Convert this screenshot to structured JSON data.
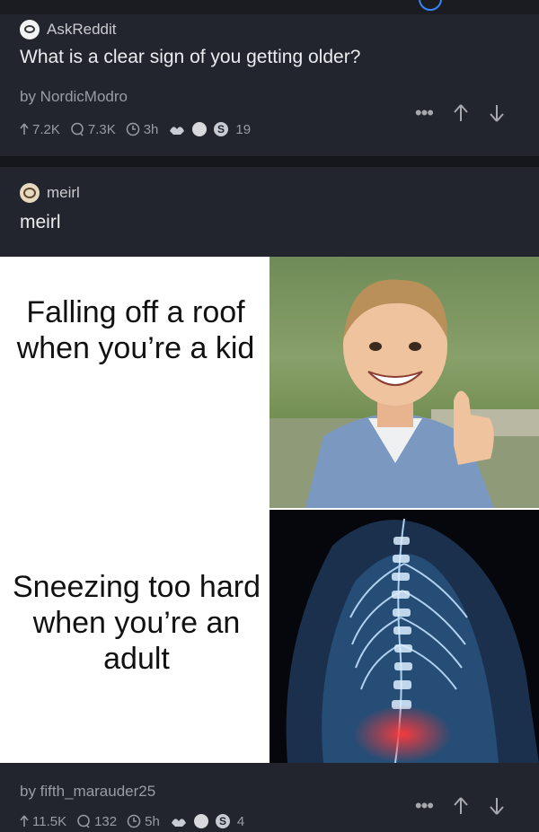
{
  "post1": {
    "subreddit": "AskReddit",
    "title": "What is a clear sign of you getting older?",
    "author": "by NordicModro",
    "upvotes": "7.2K",
    "comments": "7.3K",
    "age": "3h",
    "award_count": "19"
  },
  "post2": {
    "subreddit": "meirl",
    "title": "meirl",
    "meme_top_text": "Falling off a roof when you’re a kid",
    "meme_bottom_text": "Sneezing too hard when you’re an adult",
    "author": "by fifth_marauder25",
    "upvotes": "11.5K",
    "comments": "132",
    "age": "5h",
    "award_count": "4"
  },
  "icons": [
    "upvote-icon",
    "comment-icon",
    "clock-icon",
    "award-icon",
    "more-icon",
    "arrow-up-icon",
    "arrow-down-icon"
  ],
  "colors": {
    "background": "#1a1c22",
    "card": "#22252d",
    "accent": "#3a83f7",
    "muted_text": "#9a9ca3"
  }
}
